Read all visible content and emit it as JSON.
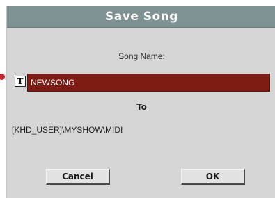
{
  "dialog": {
    "title": "Save Song",
    "song_name_label": "Song Name:",
    "song_name_value": "NEWSONG",
    "text_edit_glyph": "T",
    "to_label": "To",
    "destination_path": "[KHD_USER]\\MYSHOW\\MIDI",
    "cancel_label": "Cancel",
    "ok_label": "OK"
  },
  "colors": {
    "title_bar": "#7f9293",
    "panel": "#d6d6d6",
    "name_field": "#7c1c14",
    "pointer_dot": "#c6242a"
  },
  "icons": {
    "text_edit": "text-edit-icon"
  }
}
